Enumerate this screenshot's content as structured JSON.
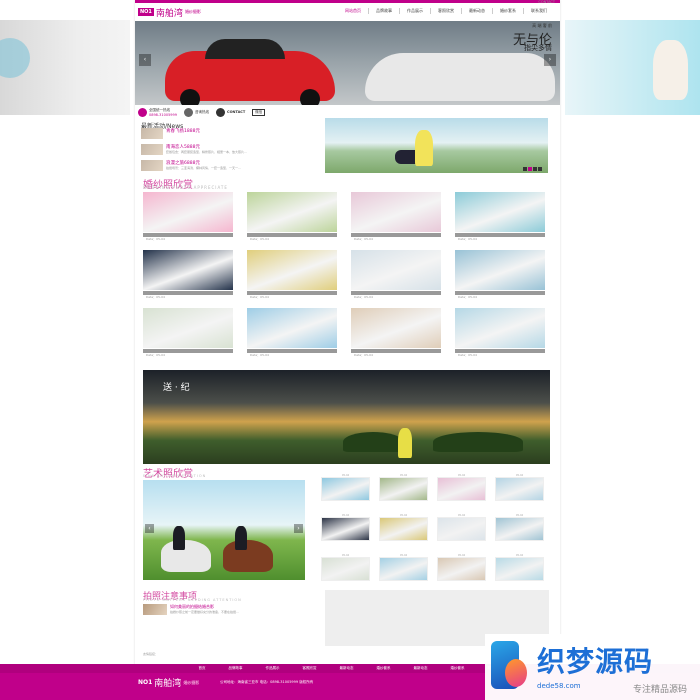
{
  "header": {
    "logo_no1": "NO1",
    "logo_name": "南舶湾",
    "logo_sub": "婚纱摄影",
    "contact_top": "CONTACT",
    "nav": [
      "网站首页",
      "品牌故事",
      "作品展示",
      "客照欣赏",
      "最新动态",
      "婚纱套系",
      "联系我们"
    ]
  },
  "banner": {
    "slogan": "无与伦",
    "slogan_small": "高 端 奢 前",
    "sub_text": "指尖多情"
  },
  "infobar": {
    "items": [
      "全国统一热线",
      "咨询热线",
      "CONTACT",
      "微信"
    ],
    "phone": "0898-31005999"
  },
  "news": {
    "title": "最新活动",
    "title_en": "/News",
    "items": [
      {
        "title": "青春飞扬1888元",
        "desc": ""
      },
      {
        "title": "南海恋人5888元",
        "desc": "套餐包含：两套服装造型、精修照片、相册一本、放大照片..."
      },
      {
        "title": "浪漫之旅6888元",
        "desc": "拍摄场景：三亚海滨、椰林风情、一套一造型、一天一..."
      }
    ]
  },
  "wedding": {
    "title": "婚纱照欣赏",
    "subtitle": "WEDDING PHOTO APPRECIATE",
    "items": [
      {
        "caption": "",
        "date": "Date：05-04",
        "photo": "#f5b6cf"
      },
      {
        "caption": "",
        "date": "Date：05-04",
        "photo": "#bcd49a"
      },
      {
        "caption": "",
        "date": "Date：05-04",
        "photo": "#e8c8d8"
      },
      {
        "caption": "",
        "date": "Date：05-04",
        "photo": "#8ccbd8"
      },
      {
        "caption": "",
        "date": "Date：05-04",
        "photo": "#23324a"
      },
      {
        "caption": "",
        "date": "Date：05-04",
        "photo": "#e0ce7c"
      },
      {
        "caption": "",
        "date": "Date：05-04",
        "photo": "#d6e1e8"
      },
      {
        "caption": "",
        "date": "Date：05-04",
        "photo": "#98c2d6"
      },
      {
        "caption": "",
        "date": "Date：05-04",
        "photo": "#d8e2d2"
      },
      {
        "caption": "",
        "date": "Date：05-04",
        "photo": "#9ecde6"
      },
      {
        "caption": "",
        "date": "Date：05-04",
        "photo": "#dfcdb8"
      },
      {
        "caption": "",
        "date": "Date：05-04",
        "photo": "#b5d8e6"
      }
    ]
  },
  "big_banner": {
    "slogan": "送 · 纪"
  },
  "art": {
    "title": "艺术照欣赏",
    "subtitle": "FINE ART APPRECIATION",
    "items": [
      {
        "label": "",
        "date": "05-04",
        "photo": "#8ec8e0"
      },
      {
        "label": "",
        "date": "05-04",
        "photo": "#a3b88a"
      },
      {
        "label": "",
        "date": "05-04",
        "photo": "#e8c0d6"
      },
      {
        "label": "",
        "date": "05-04",
        "photo": "#b4d4e4"
      },
      {
        "label": "",
        "date": "05-04",
        "photo": "#2c3446"
      },
      {
        "label": "",
        "date": "05-04",
        "photo": "#dac878"
      },
      {
        "label": "",
        "date": "05-04",
        "photo": "#dce4ea"
      },
      {
        "label": "",
        "date": "05-04",
        "photo": "#a0c4d4"
      },
      {
        "label": "",
        "date": "05-04",
        "photo": "#d8e0d4"
      },
      {
        "label": "",
        "date": "05-04",
        "photo": "#a4d0e4"
      },
      {
        "label": "",
        "date": "05-04",
        "photo": "#d9c8b4"
      },
      {
        "label": "",
        "date": "05-04",
        "photo": "#b8dae6"
      }
    ]
  },
  "notice": {
    "title": "拍照注意事项",
    "subtitle": "PHOTO MATTERS NEEDING ATTENTION",
    "item_title": "如何美丽的拍摄结婚合影",
    "item_desc": "拍婚纱照之前一定要做好充分的准备，不要在拍摄..."
  },
  "footer_links": "友情链接：",
  "footer": {
    "nav": [
      "首页",
      "品牌故事",
      "作品展示",
      "客照欣赏",
      "最新动态",
      "婚纱套系",
      "最新动态",
      "婚纱套系",
      "联系我们"
    ],
    "logo_no1": "NO1",
    "logo_name": "南舶湾",
    "logo_sub": "婚纱摄影",
    "text": "公司地址：海南省三亚市  电话：0898-31005999  版权所有"
  },
  "watermark": {
    "name": "织梦源码",
    "url": "dede58.com",
    "slogan": "专注精品源码"
  },
  "colors": {
    "brand": "#c0008a",
    "section_title": "#d34aa0"
  }
}
